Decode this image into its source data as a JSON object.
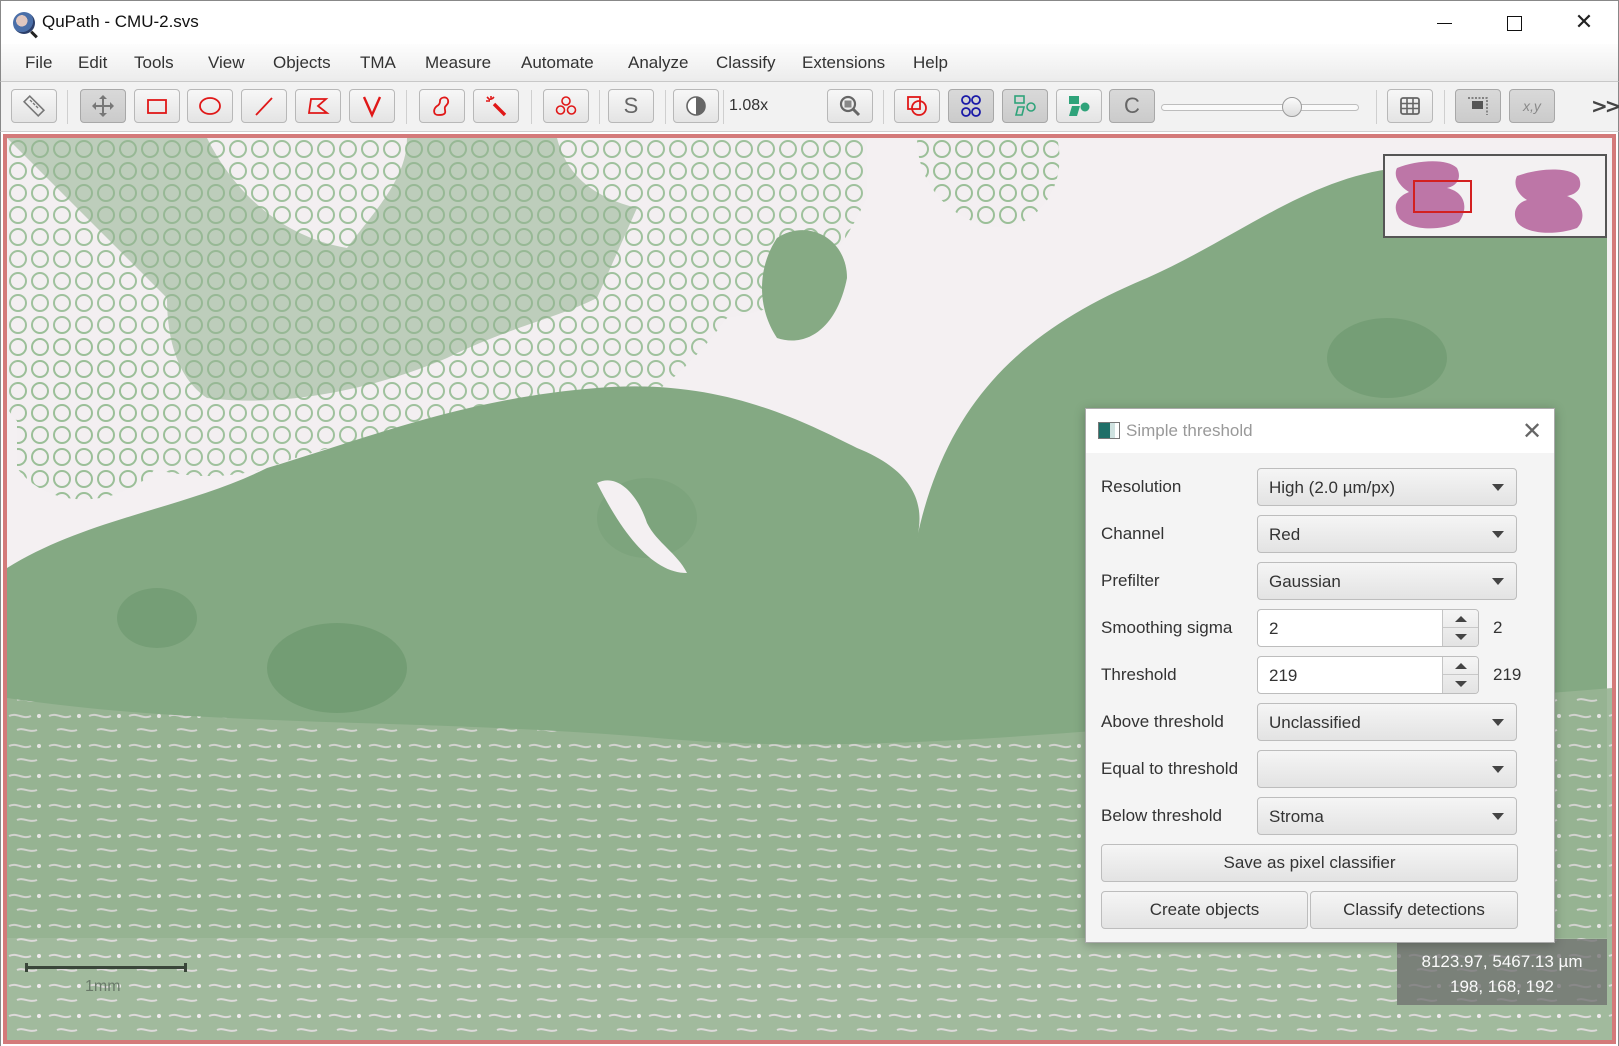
{
  "window": {
    "title": "QuPath - CMU-2.svs",
    "app_icon": "qupath-logo-icon",
    "controls": [
      "minimize",
      "maximize",
      "close"
    ]
  },
  "menu": {
    "items": [
      "File",
      "Edit",
      "Tools",
      "View",
      "Objects",
      "TMA",
      "Measure",
      "Automate",
      "Analyze",
      "Classify",
      "Extensions",
      "Help"
    ]
  },
  "toolbar": {
    "tools": [
      {
        "name": "measure-tool",
        "icon": "ruler-icon",
        "selected": false
      },
      {
        "name": "move-tool",
        "icon": "move-arrows-icon",
        "selected": true
      },
      {
        "name": "rectangle-tool",
        "icon": "rectangle-icon",
        "selected": false
      },
      {
        "name": "ellipse-tool",
        "icon": "ellipse-icon",
        "selected": false
      },
      {
        "name": "line-tool",
        "icon": "line-icon",
        "selected": false
      },
      {
        "name": "polygon-tool",
        "icon": "polygon-icon",
        "selected": false
      },
      {
        "name": "polyline-tool",
        "icon": "polyline-v-icon",
        "selected": false
      },
      {
        "name": "brush-tool",
        "icon": "brush-blob-icon",
        "selected": false
      },
      {
        "name": "wand-tool",
        "icon": "magic-wand-icon",
        "selected": false
      },
      {
        "name": "points-tool",
        "icon": "points-icon",
        "selected": false
      },
      {
        "name": "selection-mode",
        "icon": "letter-s-icon",
        "label": "S",
        "selected": false
      },
      {
        "name": "brightness-contrast",
        "icon": "contrast-icon",
        "selected": false
      },
      {
        "name": "zoom-to-fit",
        "icon": "magnifier-icon",
        "selected": false
      },
      {
        "name": "show-annotations",
        "icon": "annotations-icon",
        "selected": false
      },
      {
        "name": "show-tma-grid",
        "icon": "tma-grid-icon",
        "selected": true
      },
      {
        "name": "show-detections",
        "icon": "detections-outline-icon",
        "selected": true
      },
      {
        "name": "fill-detections",
        "icon": "detections-filled-icon",
        "selected": false
      },
      {
        "name": "show-pixel-classification",
        "icon": "letter-c-icon",
        "label": "C",
        "selected": true
      },
      {
        "name": "show-grid",
        "icon": "grid-icon",
        "selected": false
      },
      {
        "name": "show-overview",
        "icon": "overview-icon",
        "selected": true
      },
      {
        "name": "show-location",
        "icon": "xy-icon",
        "label": "x,y",
        "selected": true
      }
    ],
    "zoom_label": "1.08x",
    "opacity_slider_value": 0.68,
    "more_label": ">>",
    "colors": {
      "annotation_red": "#e01818",
      "tma_blue": "#1a1aa8",
      "detection_green": "#2fa37a"
    }
  },
  "viewer": {
    "scalebar_label": "1mm",
    "coords": {
      "position": "8123.97, 5467.13 µm",
      "rgb": "198, 168, 192"
    },
    "overview_caption": "",
    "frame_color": "#d47a7a",
    "tissue_color": "#8fb08c"
  },
  "dialog": {
    "title": "Simple threshold",
    "fields": [
      {
        "label": "Resolution",
        "type": "combo",
        "value": "High (2.0 µm/px)"
      },
      {
        "label": "Channel",
        "type": "combo",
        "value": "Red"
      },
      {
        "label": "Prefilter",
        "type": "combo",
        "value": "Gaussian"
      },
      {
        "label": "Smoothing sigma",
        "type": "spinner",
        "value": "2",
        "echo": "2"
      },
      {
        "label": "Threshold",
        "type": "spinner",
        "value": "219",
        "echo": "219"
      },
      {
        "label": "Above threshold",
        "type": "combo",
        "value": "Unclassified"
      },
      {
        "label": "Equal to threshold",
        "type": "combo",
        "value": ""
      },
      {
        "label": "Below threshold",
        "type": "combo",
        "value": "Stroma"
      }
    ],
    "buttons": {
      "save": "Save as pixel classifier",
      "create_objects": "Create objects",
      "classify_detections": "Classify detections"
    }
  }
}
